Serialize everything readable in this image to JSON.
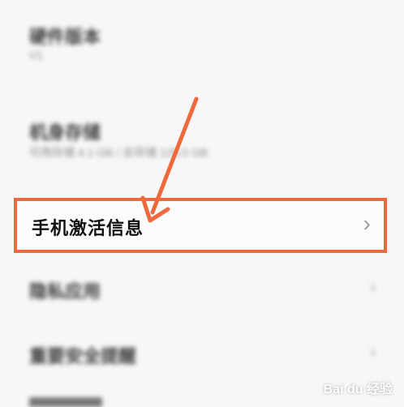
{
  "settings": {
    "rows": [
      {
        "title": "硬件版本",
        "subtitle": "V1"
      },
      {
        "title": "机身存储",
        "subtitle": "可用存储 4.1 GB / 总存储 128.0 GB"
      },
      {
        "title": "手机激活信息"
      },
      {
        "title": "隐私应用"
      },
      {
        "title": "重要安全提醒"
      }
    ]
  },
  "colors": {
    "highlight": "#ee6a3c"
  },
  "watermark": "Bai du 经验"
}
